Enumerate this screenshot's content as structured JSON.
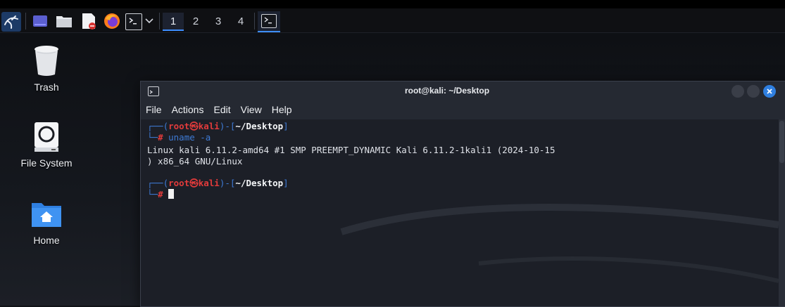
{
  "taskbar": {
    "workspaces": [
      "1",
      "2",
      "3",
      "4"
    ],
    "active_workspace": "1",
    "launchers": [
      "kali-menu-icon",
      "show-desktop-icon",
      "file-manager-icon",
      "text-editor-icon",
      "firefox-icon",
      "terminal-icon"
    ],
    "accent_color": "#3d8eff"
  },
  "desktop": {
    "icons": [
      {
        "label": "Trash",
        "icon": "trash-icon"
      },
      {
        "label": "File System",
        "icon": "drive-icon"
      },
      {
        "label": "Home",
        "icon": "home-folder-icon"
      }
    ]
  },
  "terminal": {
    "title": "root@kali: ~/Desktop",
    "menu": [
      "File",
      "Actions",
      "Edit",
      "View",
      "Help"
    ],
    "prompt": {
      "user": "root",
      "at": "㉿",
      "host": "kali",
      "path": "~/Desktop",
      "symbol": "#"
    },
    "command": "uname -a",
    "output": [
      "Linux kali 6.11.2-amd64 #1 SMP PREEMPT_DYNAMIC Kali 6.11.2-1kali1 (2024-10-15",
      ") x86_64 GNU/Linux"
    ]
  }
}
